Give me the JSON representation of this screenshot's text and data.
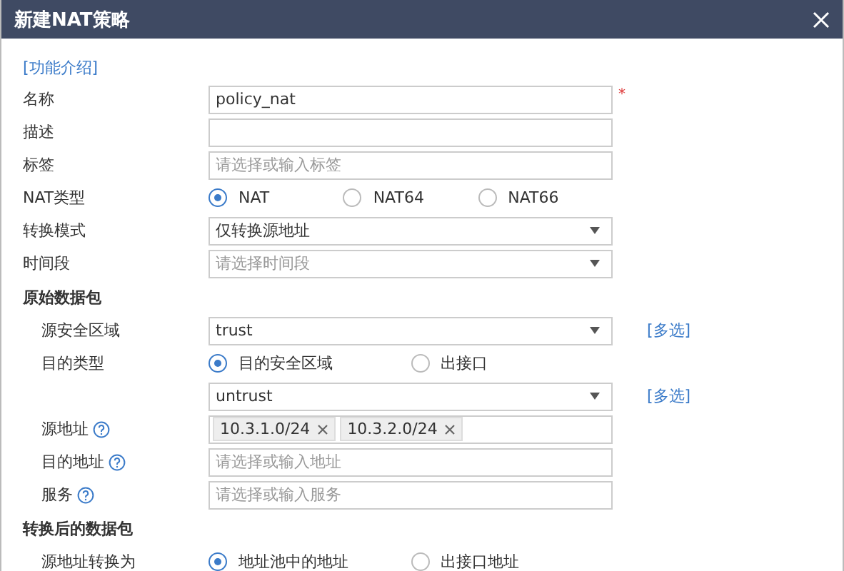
{
  "window": {
    "title": "新建NAT策略"
  },
  "intro_link": "[功能介绍]",
  "sections": [
    {
      "fields": [
        {
          "kind": "input",
          "label": "名称",
          "value": "policy_nat",
          "required_mark": "*"
        },
        {
          "kind": "input",
          "label": "描述"
        },
        {
          "kind": "input",
          "label": "标签",
          "placeholder": "请选择或输入标签"
        },
        {
          "kind": "radio",
          "label": "NAT类型",
          "options": [
            {
              "label": "NAT",
              "selected": true
            },
            {
              "label": "NAT64",
              "selected": false
            },
            {
              "label": "NAT66",
              "selected": false
            }
          ]
        },
        {
          "kind": "select",
          "label": "转换模式",
          "value": "仅转换源地址"
        },
        {
          "kind": "select",
          "label": "时间段",
          "placeholder": "请选择时间段"
        }
      ]
    },
    {
      "heading": "原始数据包",
      "fields": [
        {
          "kind": "select",
          "label": "源安全区域",
          "value": "trust",
          "link": "[多选]"
        },
        {
          "kind": "radio",
          "label": "目的类型",
          "options": [
            {
              "label": "目的安全区域",
              "selected": true
            },
            {
              "label": "出接口",
              "selected": false
            }
          ]
        },
        {
          "kind": "select",
          "value": "untrust",
          "link": "[多选]"
        },
        {
          "kind": "tags",
          "label": "源地址",
          "help": true,
          "tags": [
            "10.3.1.0/24",
            "10.3.2.0/24"
          ]
        },
        {
          "kind": "input",
          "label": "目的地址",
          "help": true,
          "placeholder": "请选择或输入地址"
        },
        {
          "kind": "input",
          "label": "服务",
          "help": true,
          "placeholder": "请选择或输入服务"
        }
      ]
    },
    {
      "heading": "转换后的数据包",
      "fields": [
        {
          "kind": "radio",
          "label": "源地址转换为",
          "options": [
            {
              "label": "地址池中的地址",
              "selected": true
            },
            {
              "label": "出接口地址",
              "selected": false
            }
          ]
        }
      ]
    }
  ]
}
